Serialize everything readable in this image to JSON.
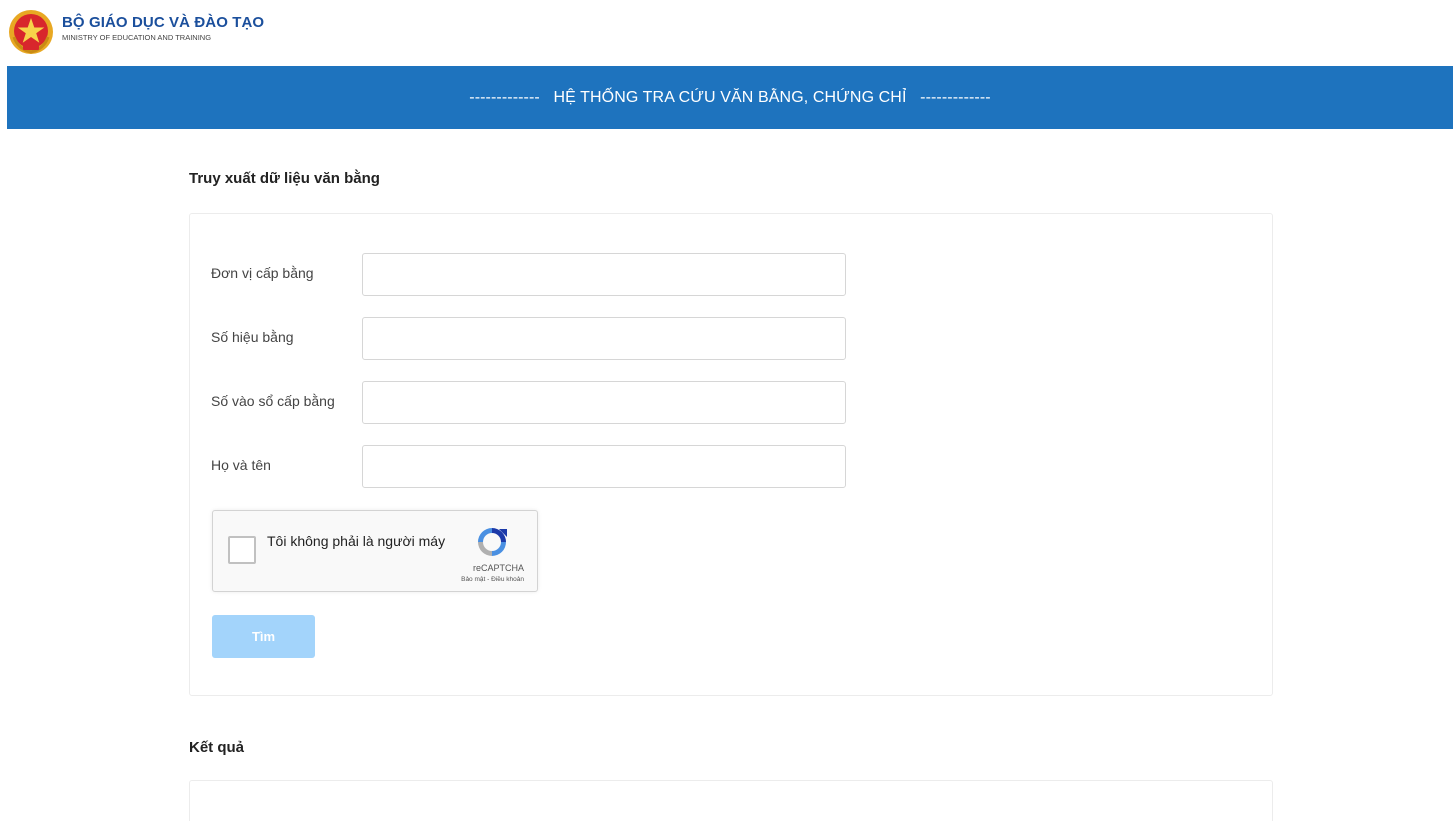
{
  "header": {
    "ministry_name": "BỘ GIÁO DỤC VÀ ĐÀO TẠO",
    "ministry_name_en": "MINISTRY OF EDUCATION AND TRAINING",
    "logo_icon": "vietnam-emblem-icon"
  },
  "banner": {
    "title": "-------------   HỆ THỐNG TRA CỨU VĂN BẰNG, CHỨNG CHỈ   -------------"
  },
  "search_section": {
    "title": "Truy xuất dữ liệu văn bằng",
    "fields": [
      {
        "label": "Đơn vị cấp bằng",
        "value": "",
        "placeholder": ""
      },
      {
        "label": "Số hiệu bằng",
        "value": "",
        "placeholder": ""
      },
      {
        "label": "Số vào sổ cấp bằng",
        "value": "",
        "placeholder": ""
      },
      {
        "label": "Họ và tên",
        "value": "",
        "placeholder": ""
      }
    ],
    "recaptcha": {
      "label": "Tôi không phải là người máy",
      "brand": "reCAPTCHA",
      "privacy": "Bảo mật",
      "separator": " - ",
      "terms": "Điều khoản",
      "icon": "recaptcha-logo-icon"
    },
    "submit_label": "Tìm"
  },
  "result_section": {
    "title": "Kết quả"
  },
  "colors": {
    "banner": "#1e73be",
    "brand_text": "#1b4f9c",
    "button_disabled": "#a3d4fb"
  }
}
